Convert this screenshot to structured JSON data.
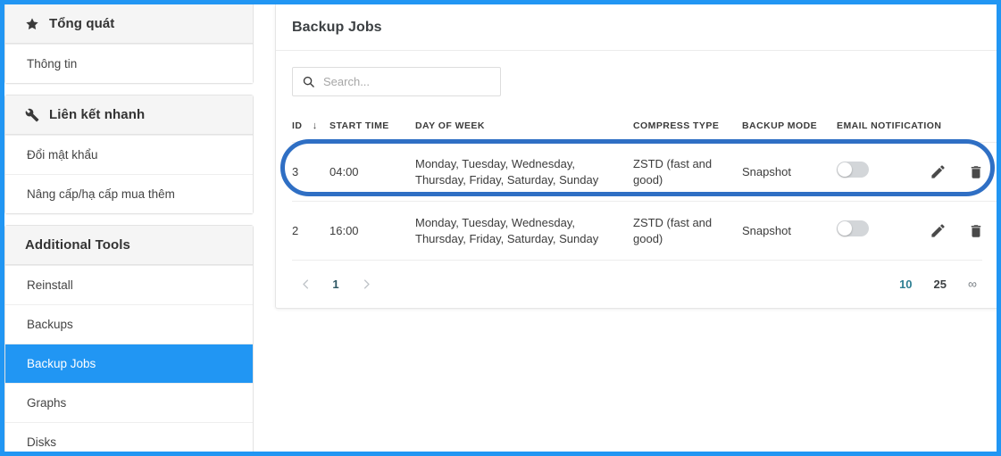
{
  "theme": {
    "accent": "#2196f3",
    "highlight_border": "#2f6fc4",
    "scrollbar_green": "#5a9a70",
    "active_page_size": "#2e7f93"
  },
  "sidebar": {
    "sections": [
      {
        "title": "Tổng quát",
        "icon": "star-icon",
        "items": [
          {
            "label": "Thông tin",
            "active": false
          }
        ]
      },
      {
        "title": "Liên kết nhanh",
        "icon": "wrench-icon",
        "items": [
          {
            "label": "Đổi mật khẩu",
            "active": false
          },
          {
            "label": "Nâng cấp/hạ cấp mua thêm",
            "active": false
          }
        ]
      },
      {
        "title": "Additional Tools",
        "icon": "",
        "items": [
          {
            "label": "Reinstall",
            "active": false
          },
          {
            "label": "Backups",
            "active": false
          },
          {
            "label": "Backup Jobs",
            "active": true
          },
          {
            "label": "Graphs",
            "active": false
          },
          {
            "label": "Disks",
            "active": false
          }
        ]
      }
    ]
  },
  "main": {
    "title": "Backup Jobs",
    "search": {
      "icon": "search-icon",
      "value": "",
      "placeholder": "Search..."
    },
    "table": {
      "columns": [
        {
          "key": "id",
          "label": "ID",
          "sort_icon": "↓"
        },
        {
          "key": "start_time",
          "label": "START TIME"
        },
        {
          "key": "day_of_week",
          "label": "DAY OF WEEK"
        },
        {
          "key": "compress_type",
          "label": "COMPRESS TYPE"
        },
        {
          "key": "backup_mode",
          "label": "BACKUP MODE"
        },
        {
          "key": "email_notification",
          "label": "EMAIL NOTIFICATION"
        },
        {
          "key": "actions",
          "label": ""
        }
      ],
      "rows": [
        {
          "id": "3",
          "start_time": "04:00",
          "day_of_week": "Monday, Tuesday, Wednesday, Thursday, Friday, Saturday, Sunday",
          "compress_type": "ZSTD (fast and good)",
          "backup_mode": "Snapshot",
          "email_notification_on": false,
          "highlighted": true,
          "actions": [
            {
              "name": "edit-icon"
            },
            {
              "name": "delete-icon"
            }
          ]
        },
        {
          "id": "2",
          "start_time": "16:00",
          "day_of_week": "Monday, Tuesday, Wednesday, Thursday, Friday, Saturday, Sunday",
          "compress_type": "ZSTD (fast and good)",
          "backup_mode": "Snapshot",
          "email_notification_on": false,
          "highlighted": false,
          "actions": [
            {
              "name": "edit-icon"
            },
            {
              "name": "delete-icon"
            }
          ]
        }
      ]
    },
    "pagination": {
      "prev_icon": "chevron-left-icon",
      "next_icon": "chevron-right-icon",
      "current_page": "1",
      "page_sizes": [
        {
          "label": "10",
          "active": true
        },
        {
          "label": "25",
          "active": false
        },
        {
          "label": "∞",
          "active": false
        }
      ]
    }
  }
}
